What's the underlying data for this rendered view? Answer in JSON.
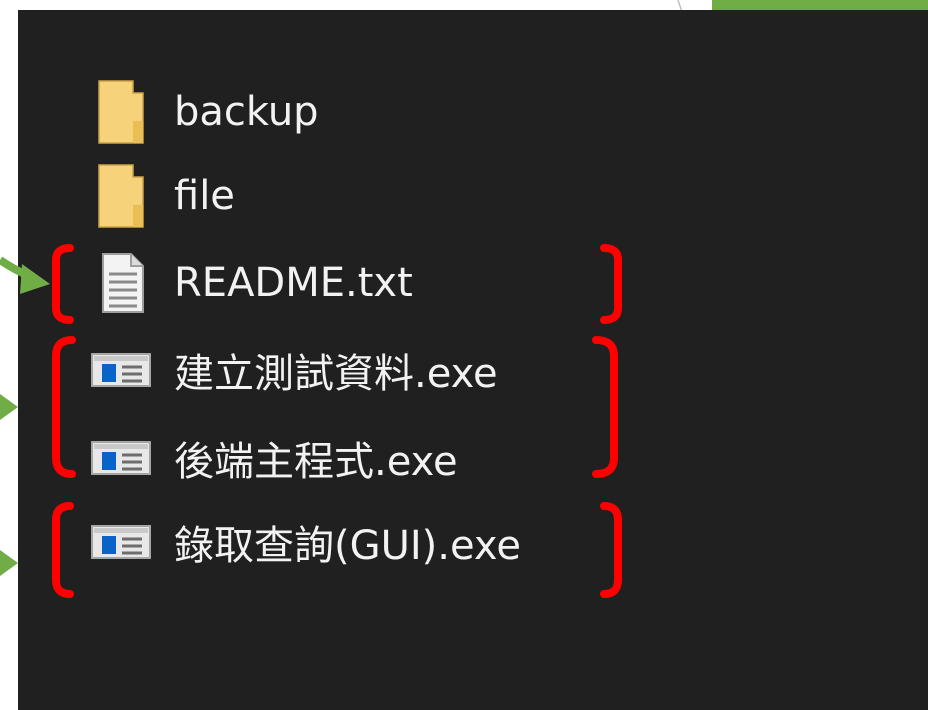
{
  "explorer": {
    "items": [
      {
        "name": "backup",
        "icon": "folder-icon",
        "highlighted": false
      },
      {
        "name": "file",
        "icon": "folder-icon",
        "highlighted": false
      },
      {
        "name": "README.txt",
        "icon": "text-document-icon",
        "highlighted": true
      },
      {
        "name": "建立測試資料.exe",
        "icon": "executable-icon",
        "highlighted": true
      },
      {
        "name": "後端主程式.exe",
        "icon": "executable-icon",
        "highlighted": true
      },
      {
        "name": "錄取查詢(GUI).exe",
        "icon": "executable-icon",
        "highlighted": true
      }
    ]
  },
  "colors": {
    "explorer_background": "#202020",
    "text": "#f2f2f2",
    "folder": "#f6d37a",
    "bracket": "#ff0000",
    "arrow": "#70ad47",
    "exe_accent": "#0a64c8"
  }
}
